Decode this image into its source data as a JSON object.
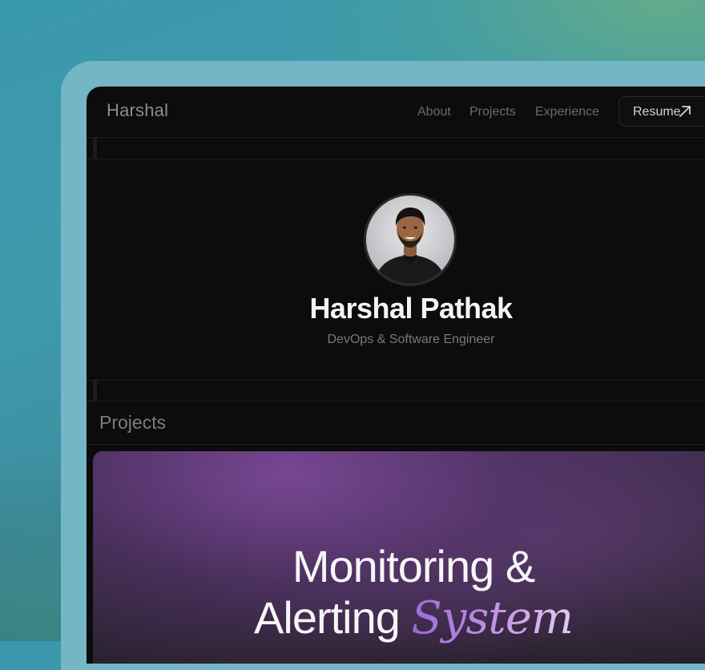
{
  "nav": {
    "brand": "Harshal",
    "links": [
      "About",
      "Projects",
      "Experience"
    ],
    "resume_label": "Resume"
  },
  "profile": {
    "name": "Harshal Pathak",
    "role": "DevOps & Software Engineer"
  },
  "projects": {
    "title": "Projects",
    "featured": {
      "title_line1": "Monitoring &",
      "title_line2_plain": "Alerting",
      "title_line2_accent": "System"
    }
  },
  "colors": {
    "background_teal": "#3a98ad",
    "frame": "#74b6c6",
    "screen": "#0c0c0c",
    "accent_purple": "#9a6ad8"
  },
  "icons": {
    "resume": "arrow-up-right-icon"
  }
}
